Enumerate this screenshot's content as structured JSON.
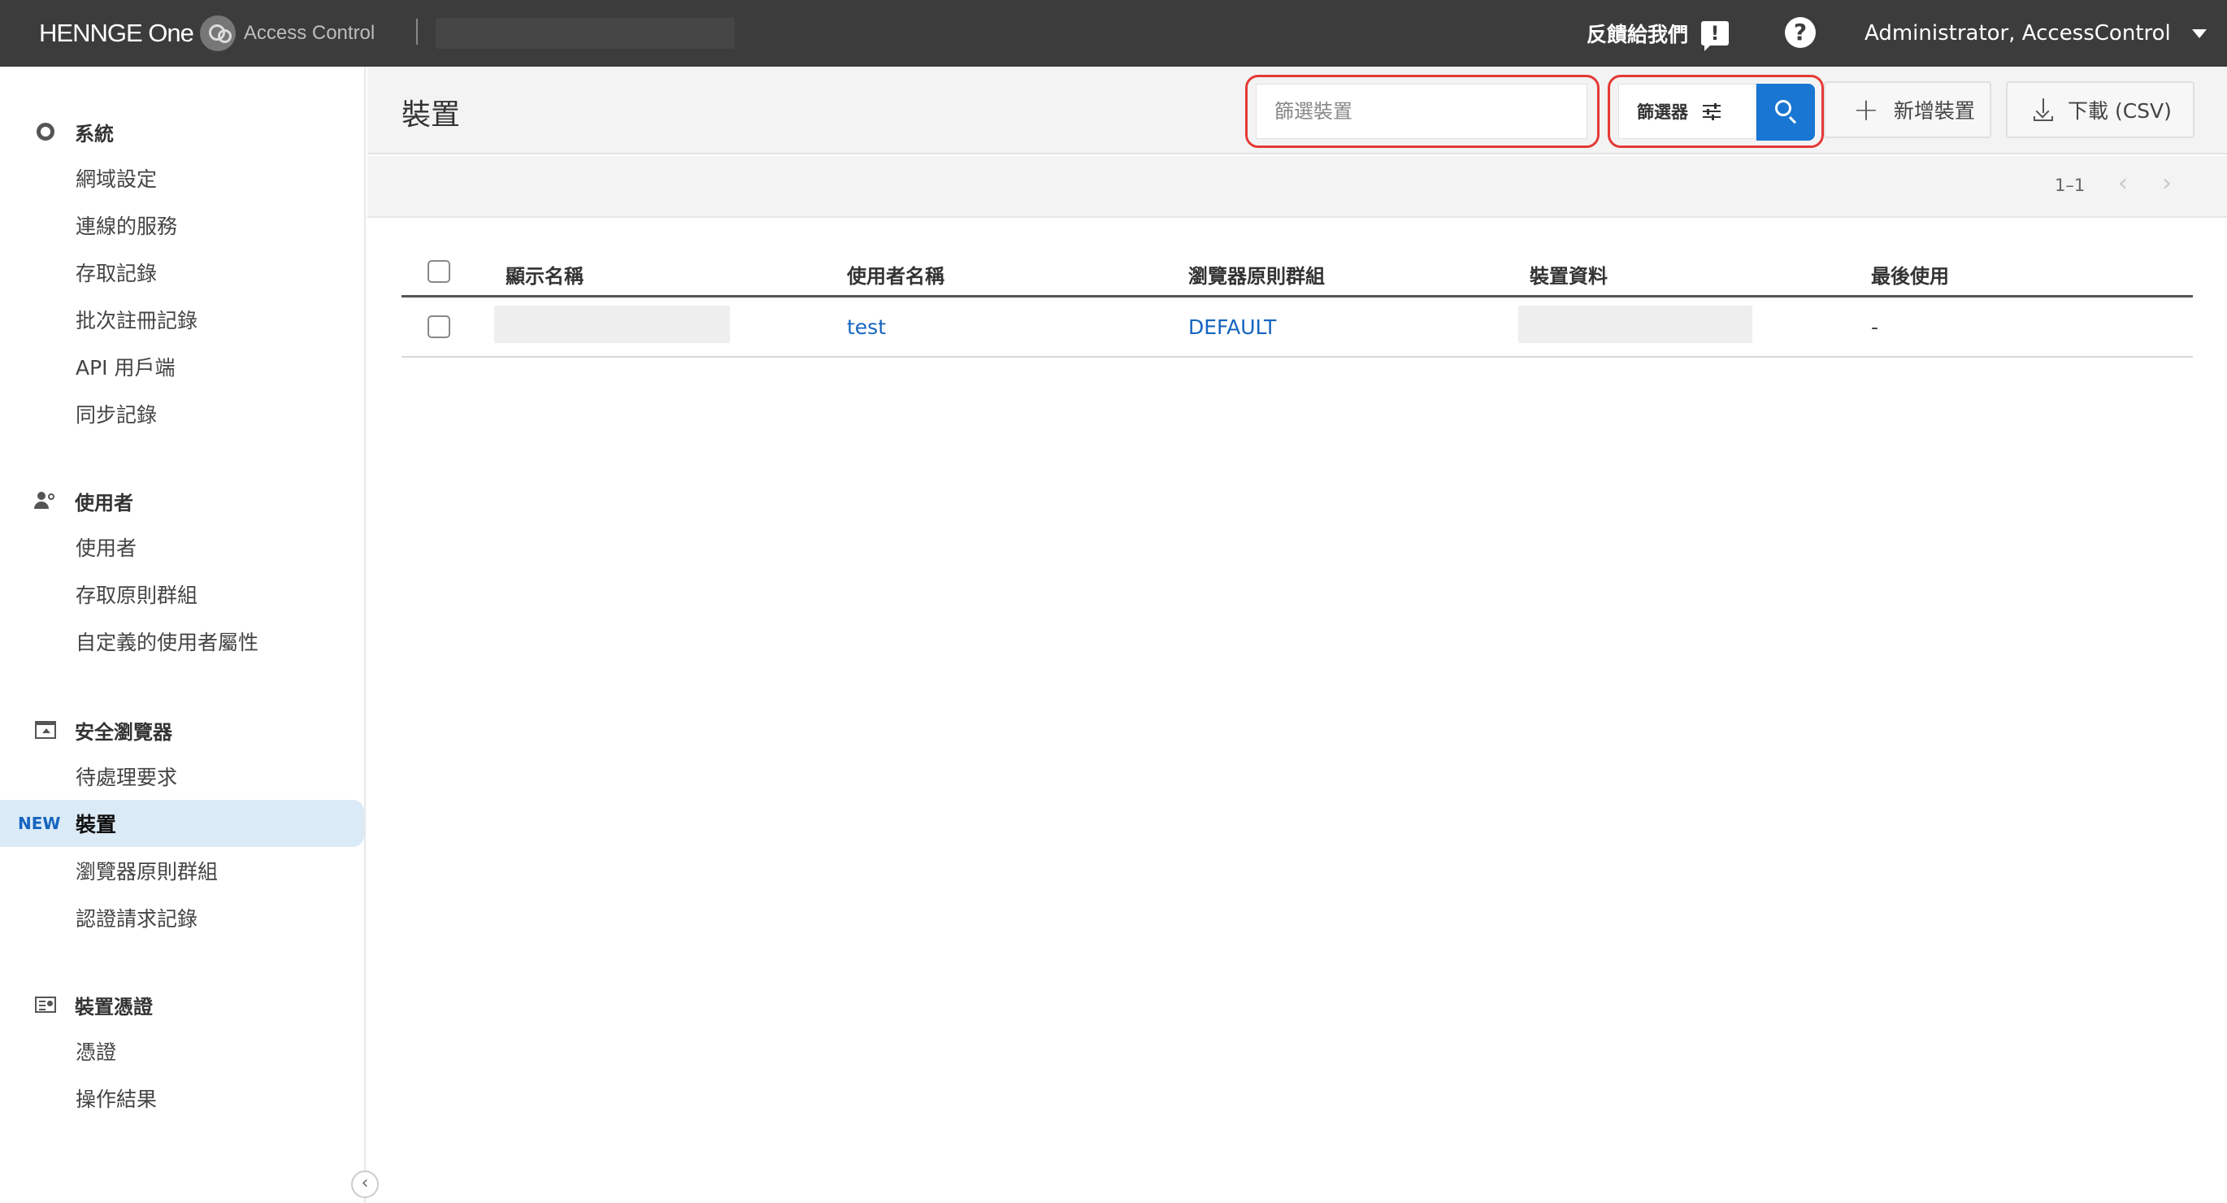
{
  "topbar": {
    "brand_name": "HENNGE One",
    "app_name": "Access Control",
    "feedback_label": "反饋給我們",
    "account_label": "Administrator, AccessControl"
  },
  "sidebar": {
    "sections": [
      {
        "title": "系統",
        "icon": "gear-icon",
        "items": [
          "網域設定",
          "連線的服務",
          "存取記錄",
          "批次註冊記錄",
          "API 用戶端",
          "同步記錄"
        ]
      },
      {
        "title": "使用者",
        "icon": "users-icon",
        "items": [
          "使用者",
          "存取原則群組",
          "自定義的使用者屬性"
        ]
      },
      {
        "title": "安全瀏覽器",
        "icon": "browser-icon",
        "items": [
          "待處理要求",
          "裝置",
          "瀏覽器原則群組",
          "認證請求記錄"
        ]
      },
      {
        "title": "裝置憑證",
        "icon": "certificate-icon",
        "items": [
          "憑證",
          "操作結果"
        ]
      }
    ],
    "active_item": "裝置",
    "new_badge": "NEW"
  },
  "main": {
    "title": "裝置",
    "search_placeholder": "篩選裝置",
    "filter_label": "篩選器",
    "add_label": "新增裝置",
    "download_label": "下載 (CSV)",
    "pagination": "1–1",
    "highlight_color": "#e53935",
    "accent_color": "#1976d2"
  },
  "table": {
    "columns": [
      "顯示名稱",
      "使用者名稱",
      "瀏覽器原則群組",
      "裝置資料",
      "最後使用"
    ],
    "rows": [
      {
        "display_name": "",
        "username": "test",
        "policy_group": "DEFAULT",
        "device_info": "",
        "last_used": "-"
      }
    ]
  }
}
